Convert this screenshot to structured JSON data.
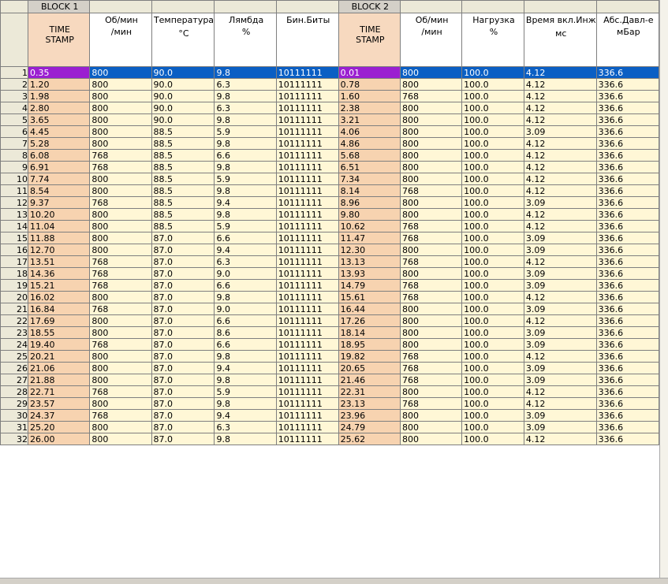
{
  "blocks": {
    "block1": "BLOCK 1",
    "block2": "BLOCK 2"
  },
  "columns": [
    {
      "line1": "TIME",
      "line2": "STAMP",
      "line3": ""
    },
    {
      "line1": "Об/мин",
      "line2": "/мин",
      "line3": ""
    },
    {
      "line1": "Температура",
      "line2": "",
      "line3": "°C"
    },
    {
      "line1": "Лямбда",
      "line2": "%",
      "line3": ""
    },
    {
      "line1": "Бин.Биты",
      "line2": "",
      "line3": ""
    },
    {
      "line1": "TIME",
      "line2": "STAMP",
      "line3": ""
    },
    {
      "line1": "Об/мин",
      "line2": "/мин",
      "line3": ""
    },
    {
      "line1": "Нагрузка",
      "line2": "%",
      "line3": ""
    },
    {
      "line1": "Время вкл.Инж",
      "line2": "",
      "line3": "мс"
    },
    {
      "line1": "Абс.Давл-е",
      "line2": "мБар",
      "line3": ""
    }
  ],
  "selected_row": 1,
  "rows": [
    [
      "1",
      "0.35",
      "800",
      "90.0",
      "9.8",
      "10111111",
      "0.01",
      "800",
      "100.0",
      "4.12",
      "336.6"
    ],
    [
      "2",
      "1.20",
      "800",
      "90.0",
      "6.3",
      "10111111",
      "0.78",
      "800",
      "100.0",
      "4.12",
      "336.6"
    ],
    [
      "3",
      "1.98",
      "800",
      "90.0",
      "9.8",
      "10111111",
      "1.60",
      "768",
      "100.0",
      "4.12",
      "336.6"
    ],
    [
      "4",
      "2.80",
      "800",
      "90.0",
      "6.3",
      "10111111",
      "2.38",
      "800",
      "100.0",
      "4.12",
      "336.6"
    ],
    [
      "5",
      "3.65",
      "800",
      "90.0",
      "9.8",
      "10111111",
      "3.21",
      "800",
      "100.0",
      "4.12",
      "336.6"
    ],
    [
      "6",
      "4.45",
      "800",
      "88.5",
      "5.9",
      "10111111",
      "4.06",
      "800",
      "100.0",
      "3.09",
      "336.6"
    ],
    [
      "7",
      "5.28",
      "800",
      "88.5",
      "9.8",
      "10111111",
      "4.86",
      "800",
      "100.0",
      "4.12",
      "336.6"
    ],
    [
      "8",
      "6.08",
      "768",
      "88.5",
      "6.6",
      "10111111",
      "5.68",
      "800",
      "100.0",
      "4.12",
      "336.6"
    ],
    [
      "9",
      "6.91",
      "768",
      "88.5",
      "9.8",
      "10111111",
      "6.51",
      "800",
      "100.0",
      "4.12",
      "336.6"
    ],
    [
      "10",
      "7.74",
      "800",
      "88.5",
      "5.9",
      "10111111",
      "7.34",
      "800",
      "100.0",
      "4.12",
      "336.6"
    ],
    [
      "11",
      "8.54",
      "800",
      "88.5",
      "9.8",
      "10111111",
      "8.14",
      "768",
      "100.0",
      "4.12",
      "336.6"
    ],
    [
      "12",
      "9.37",
      "768",
      "88.5",
      "9.4",
      "10111111",
      "8.96",
      "800",
      "100.0",
      "3.09",
      "336.6"
    ],
    [
      "13",
      "10.20",
      "800",
      "88.5",
      "9.8",
      "10111111",
      "9.80",
      "800",
      "100.0",
      "4.12",
      "336.6"
    ],
    [
      "14",
      "11.04",
      "800",
      "88.5",
      "5.9",
      "10111111",
      "10.62",
      "768",
      "100.0",
      "4.12",
      "336.6"
    ],
    [
      "15",
      "11.88",
      "800",
      "87.0",
      "6.6",
      "10111111",
      "11.47",
      "768",
      "100.0",
      "3.09",
      "336.6"
    ],
    [
      "16",
      "12.70",
      "800",
      "87.0",
      "9.4",
      "10111111",
      "12.30",
      "800",
      "100.0",
      "3.09",
      "336.6"
    ],
    [
      "17",
      "13.51",
      "768",
      "87.0",
      "6.3",
      "10111111",
      "13.13",
      "768",
      "100.0",
      "4.12",
      "336.6"
    ],
    [
      "18",
      "14.36",
      "768",
      "87.0",
      "9.0",
      "10111111",
      "13.93",
      "800",
      "100.0",
      "3.09",
      "336.6"
    ],
    [
      "19",
      "15.21",
      "768",
      "87.0",
      "6.6",
      "10111111",
      "14.79",
      "768",
      "100.0",
      "3.09",
      "336.6"
    ],
    [
      "20",
      "16.02",
      "800",
      "87.0",
      "9.8",
      "10111111",
      "15.61",
      "768",
      "100.0",
      "4.12",
      "336.6"
    ],
    [
      "21",
      "16.84",
      "768",
      "87.0",
      "9.0",
      "10111111",
      "16.44",
      "800",
      "100.0",
      "3.09",
      "336.6"
    ],
    [
      "22",
      "17.69",
      "800",
      "87.0",
      "6.6",
      "10111111",
      "17.26",
      "800",
      "100.0",
      "4.12",
      "336.6"
    ],
    [
      "23",
      "18.55",
      "800",
      "87.0",
      "8.6",
      "10111111",
      "18.14",
      "800",
      "100.0",
      "3.09",
      "336.6"
    ],
    [
      "24",
      "19.40",
      "768",
      "87.0",
      "6.6",
      "10111111",
      "18.95",
      "800",
      "100.0",
      "3.09",
      "336.6"
    ],
    [
      "25",
      "20.21",
      "800",
      "87.0",
      "9.8",
      "10111111",
      "19.82",
      "768",
      "100.0",
      "4.12",
      "336.6"
    ],
    [
      "26",
      "21.06",
      "800",
      "87.0",
      "9.4",
      "10111111",
      "20.65",
      "768",
      "100.0",
      "3.09",
      "336.6"
    ],
    [
      "27",
      "21.88",
      "800",
      "87.0",
      "9.8",
      "10111111",
      "21.46",
      "768",
      "100.0",
      "3.09",
      "336.6"
    ],
    [
      "28",
      "22.71",
      "768",
      "87.0",
      "5.9",
      "10111111",
      "22.31",
      "800",
      "100.0",
      "4.12",
      "336.6"
    ],
    [
      "29",
      "23.57",
      "800",
      "87.0",
      "9.8",
      "10111111",
      "23.13",
      "768",
      "100.0",
      "4.12",
      "336.6"
    ],
    [
      "30",
      "24.37",
      "768",
      "87.0",
      "9.4",
      "10111111",
      "23.96",
      "800",
      "100.0",
      "3.09",
      "336.6"
    ],
    [
      "31",
      "25.20",
      "800",
      "87.0",
      "6.3",
      "10111111",
      "24.79",
      "800",
      "100.0",
      "3.09",
      "336.6"
    ],
    [
      "32",
      "26.00",
      "800",
      "87.0",
      "9.8",
      "10111111",
      "25.62",
      "800",
      "100.0",
      "4.12",
      "336.6"
    ]
  ]
}
